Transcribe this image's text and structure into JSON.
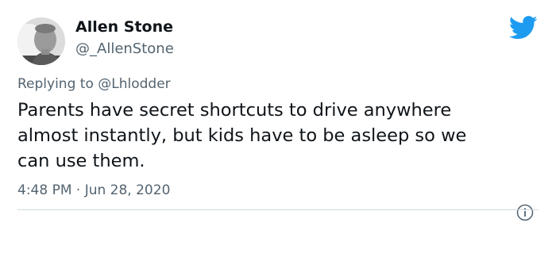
{
  "tweet": {
    "author_name": "Allen Stone",
    "author_handle": "@_AllenStone",
    "replying_prefix": "Replying to ",
    "replying_to": "@Lhlodder",
    "text": "Parents have secret shortcuts to drive anywhere\nalmost instantly, but kids have to be asleep so we\ncan use them.",
    "timestamp": "4:48 PM · Jun 28, 2020"
  },
  "icons": {
    "brand": "twitter-bird-icon",
    "info": "info-icon"
  },
  "colors": {
    "brand_blue": "#1d9bf0",
    "text_primary": "#0f1419",
    "text_secondary": "#536471",
    "divider": "#cfd9de"
  }
}
